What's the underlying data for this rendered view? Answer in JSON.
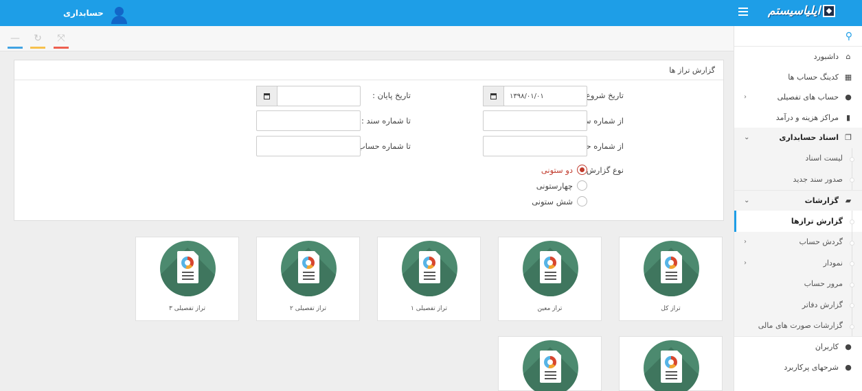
{
  "topbar": {
    "user_name": "حسابداری",
    "logo_text": "ایلیاسیستم",
    "accent_color": "#1e9ee7"
  },
  "toolstrip": {
    "icons": [
      "minimize-icon",
      "refresh-icon",
      "expand-icon"
    ]
  },
  "sidebar": {
    "search_icon": "search-icon",
    "items": [
      {
        "label": "داشبورد",
        "icon": "home-icon"
      },
      {
        "label": "کدینگ حساب ها",
        "icon": "grid-icon"
      },
      {
        "label": "حساب های تفصیلی",
        "icon": "users-icon"
      },
      {
        "label": "مراکز هزینه و درآمد",
        "icon": "building-icon"
      },
      {
        "label": "اسناد حسابداری",
        "icon": "copy-icon"
      },
      {
        "label": "لیست اسناد"
      },
      {
        "label": "صدور سند جدید"
      },
      {
        "label": "گزارشات",
        "icon": "book-icon"
      },
      {
        "label": "گزارش ترازها"
      },
      {
        "label": "گردش حساب"
      },
      {
        "label": "نمودار"
      },
      {
        "label": "مرور حساب"
      },
      {
        "label": "گزارش دفاتر"
      },
      {
        "label": "گزارشات صورت های مالی"
      },
      {
        "label": "کاربران",
        "icon": "user-icon"
      },
      {
        "label": "شرحهای پرکاربرد",
        "icon": "user-icon"
      }
    ]
  },
  "panel": {
    "title": "گزارش تراز ها",
    "start_date_label": "تاریخ شروع :",
    "start_date_value": "۱۳۹۸/۰۱/۰۱",
    "end_date_label": "تاریخ پایان :",
    "end_date_value": "",
    "from_doc_label": "از شماره سند :",
    "to_doc_label": "تا شماره سند :",
    "from_account_label": "از شماره حساب :",
    "to_account_label": "تا شماره حساب :",
    "report_type_label": "نوع گزارش :",
    "report_types": [
      "دو ستونی",
      "چهارستونی",
      "شش ستونی"
    ],
    "selected_report_type": "دو ستونی",
    "selected_color": "#c0392b"
  },
  "tiles": [
    {
      "label": "تراز کل"
    },
    {
      "label": "تراز معین"
    },
    {
      "label": "تراز تفصیلی ۱"
    },
    {
      "label": "تراز تفصیلی ۲"
    },
    {
      "label": "تراز تفصیلی ۳"
    }
  ]
}
